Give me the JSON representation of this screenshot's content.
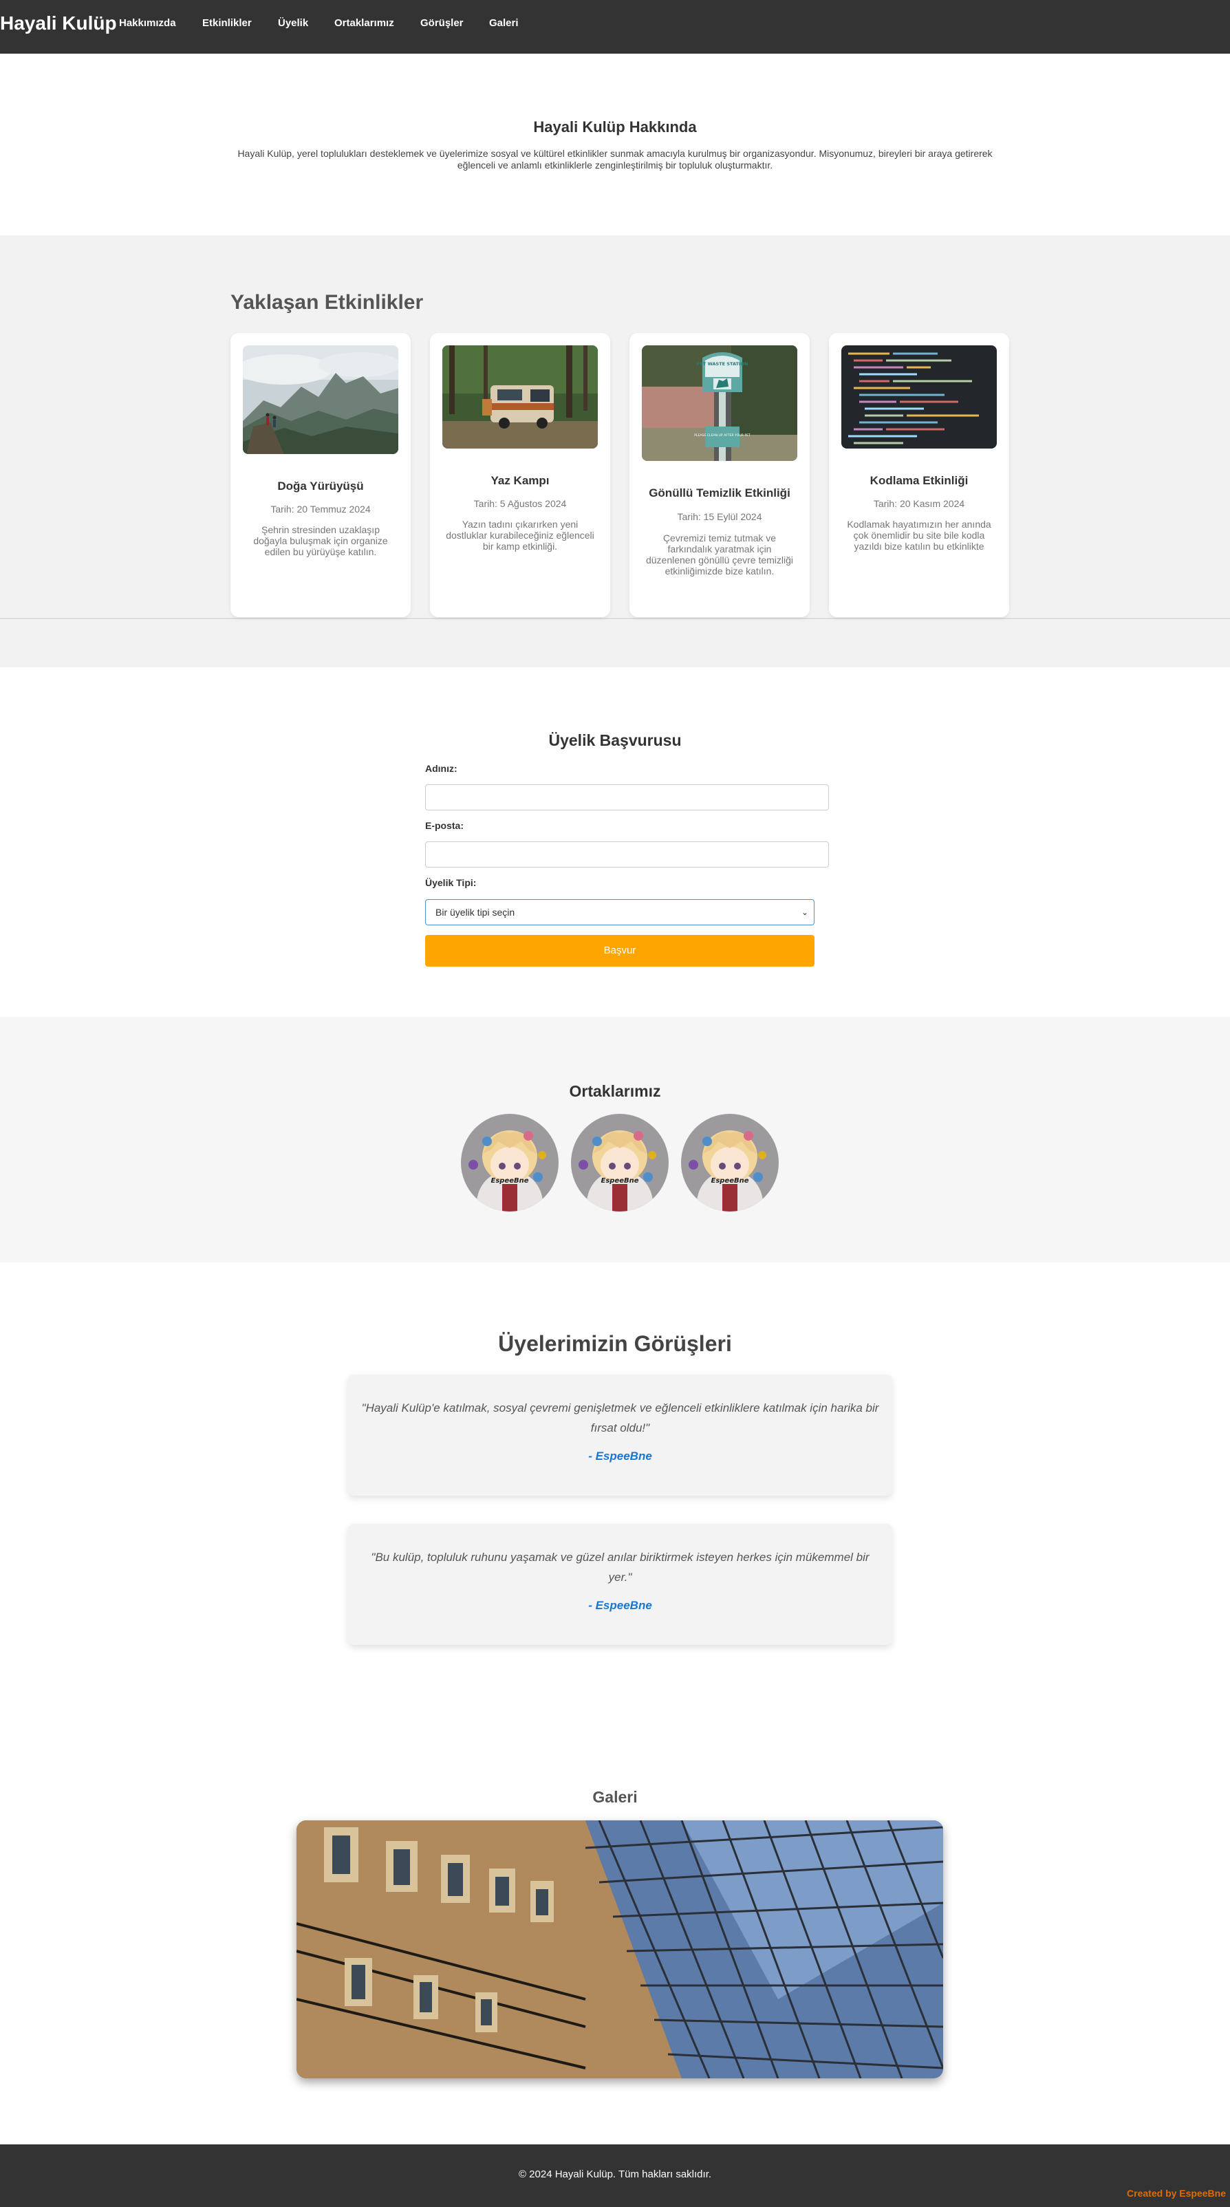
{
  "nav": {
    "brand": "Hayali Kulüp",
    "links": [
      "Hakkımızda",
      "Etkinlikler",
      "Üyelik",
      "Ortaklarımız",
      "Görüşler",
      "Galeri"
    ]
  },
  "about": {
    "title": "Hayali Kulüp Hakkında",
    "text": "Hayali Kulüp, yerel toplulukları desteklemek ve üyelerimize sosyal ve kültürel etkinlikler sunmak amacıyla kurulmuş bir organizasyondur. Misyonumuz, bireyleri bir araya getirerek eğlenceli ve anlamlı etkinliklerle zenginleştirilmiş bir topluluk oluşturmaktır."
  },
  "events": {
    "title": "Yaklaşan Etkinlikler",
    "items": [
      {
        "title": "Doğa Yürüyüşü",
        "date": "Tarih: 20 Temmuz 2024",
        "desc": "Şehrin stresinden uzaklaşıp doğayla buluşmak için organize edilen bu yürüyüşe katılın.",
        "image": "mountain-hikers-photo"
      },
      {
        "title": "Yaz Kampı",
        "date": "Tarih: 5 Ağustos 2024",
        "desc": "Yazın tadını çıkarırken yeni dostluklar kurabileceğiniz eğlenceli bir kamp etkinliği.",
        "image": "camper-van-forest-photo"
      },
      {
        "title": "Gönüllü Temizlik Etkinliği",
        "date": "Tarih: 15 Eylül 2024",
        "desc": "Çevremizi temiz tutmak ve farkındalık yaratmak için düzenlenen gönüllü çevre temizliği etkinliğimizde bize katılın.",
        "image": "pet-waste-station-photo",
        "sign": {
          "top": "PET WASTE STATION",
          "bottom": "PLEASE CLEAN UP AFTER YOUR PET"
        }
      },
      {
        "title": "Kodlama Etkinliği",
        "date": "Tarih: 20 Kasım 2024",
        "desc": "Kodlamak hayatımızın her anında çok önemlidir bu site bile kodla yazıldı bize katılın bu etkinlikte",
        "image": "code-screen-photo"
      }
    ]
  },
  "membership": {
    "title": "Üyelik Başvurusu",
    "name_label": "Adınız:",
    "email_label": "E-posta:",
    "type_label": "Üyelik Tipi:",
    "type_selected": "Bir üyelik tipi seçin",
    "submit_label": "Başvur"
  },
  "partners": {
    "title": "Ortaklarımız",
    "logos": [
      {
        "icon": "anime-avatar-logo",
        "text": "EspeeBne"
      },
      {
        "icon": "anime-avatar-logo",
        "text": "EspeeBne"
      },
      {
        "icon": "anime-avatar-logo",
        "text": "EspeeBne"
      }
    ]
  },
  "testimonials": {
    "title": "Üyelerimizin Görüşleri",
    "items": [
      {
        "quote": "\"Hayali Kulüp'e katılmak, sosyal çevremi genişletmek ve eğlenceli etkinliklere katılmak için harika bir fırsat oldu!\"",
        "author": "- EspeeBne"
      },
      {
        "quote": "\"Bu kulüp, topluluk ruhunu yaşamak ve güzel anılar biriktirmek isteyen herkes için mükemmel bir yer.\"",
        "author": "- EspeeBne"
      }
    ]
  },
  "gallery": {
    "title": "Galeri",
    "image": "gallery-arcade-building-photo"
  },
  "footer": {
    "copyright": "© 2024 Hayali Kulüp. Tüm hakları saklıdır.",
    "credit": "Created by EspeeBne"
  },
  "colors": {
    "nav_bg": "#333333",
    "accent_button": "#ffa500",
    "author_link": "#1976d2",
    "credit": "#e06b00",
    "section_bg": "#f2f2f2"
  }
}
